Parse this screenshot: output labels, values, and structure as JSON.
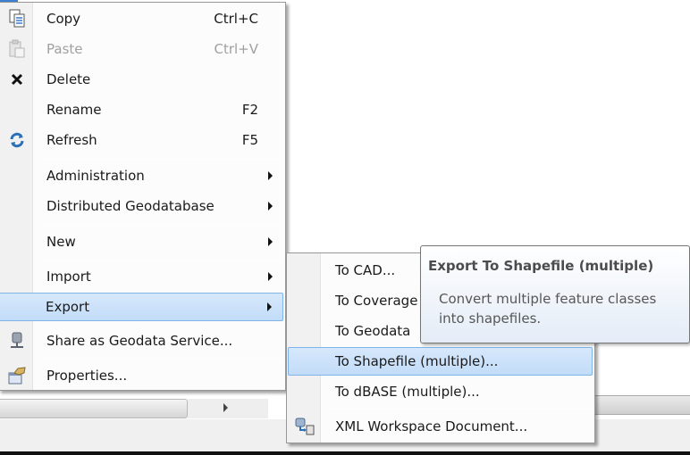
{
  "context_menu": {
    "items": [
      {
        "label": "Copy",
        "shortcut": "Ctrl+C",
        "icon": "copy-icon",
        "enabled": true
      },
      {
        "label": "Paste",
        "shortcut": "Ctrl+V",
        "icon": "paste-icon",
        "enabled": false
      },
      {
        "label": "Delete",
        "shortcut": "",
        "icon": "delete-icon",
        "enabled": true
      },
      {
        "label": "Rename",
        "shortcut": "F2",
        "icon": "",
        "enabled": true
      },
      {
        "label": "Refresh",
        "shortcut": "F5",
        "icon": "refresh-icon",
        "enabled": true
      },
      {
        "label": "Administration",
        "submenu": true
      },
      {
        "label": "Distributed Geodatabase",
        "submenu": true
      },
      {
        "label": "New",
        "submenu": true
      },
      {
        "label": "Import",
        "submenu": true
      },
      {
        "label": "Export",
        "submenu": true,
        "selected": true
      },
      {
        "label": "Share as Geodata Service...",
        "icon": "geodata-service-icon"
      },
      {
        "label": "Properties...",
        "icon": "properties-icon"
      }
    ]
  },
  "export_submenu": {
    "items": [
      {
        "label": "To CAD..."
      },
      {
        "label": "To Coverage"
      },
      {
        "label": "To Geodata"
      },
      {
        "label": "To Shapefile (multiple)...",
        "selected": true
      },
      {
        "label": "To dBASE (multiple)..."
      },
      {
        "label": "XML Workspace Document...",
        "icon": "xml-workspace-icon"
      }
    ]
  },
  "tooltip": {
    "title": "Export To Shapefile (multiple)",
    "body": "Convert multiple feature classes into shapefiles."
  },
  "colors": {
    "selection_bg": "#c9e0f7",
    "selection_border": "#7eb4ea",
    "disabled_text": "#a0a0a0"
  }
}
